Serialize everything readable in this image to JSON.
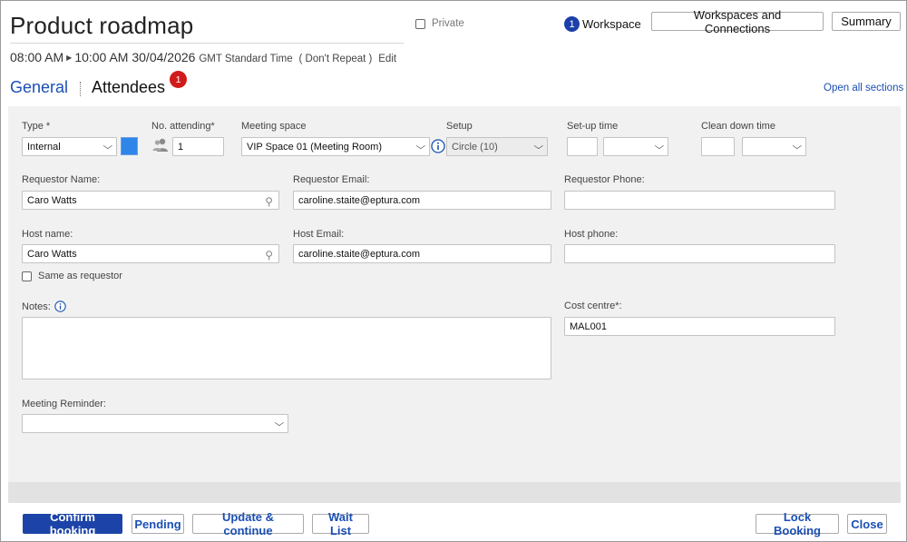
{
  "header": {
    "title": "Product roadmap",
    "start_time": "08:00 AM",
    "end_time": "10:00 AM 30/04/2026",
    "timezone": "GMT Standard Time",
    "repeat": "( Don't Repeat )",
    "edit_link": "Edit",
    "private_label": "Private",
    "workspace_count": "1",
    "workspace_label": "Workspace",
    "workspaces_connections_button": "Workspaces and Connections",
    "summary_button": "Summary"
  },
  "tabs": {
    "general": "General",
    "attendees": "Attendees",
    "attendees_badge": "1",
    "open_all_sections": "Open all sections"
  },
  "form": {
    "type": {
      "label": "Type *",
      "value": "Internal",
      "color": "#2f86e8"
    },
    "attending": {
      "label": "No. attending*",
      "value": "1"
    },
    "meeting_space": {
      "label": "Meeting space",
      "value": "VIP Space 01 (Meeting Room)"
    },
    "setup": {
      "label": "Setup",
      "value": "Circle (10)"
    },
    "setup_time": {
      "label": "Set-up time",
      "value": "",
      "unit": ""
    },
    "clean_time": {
      "label": "Clean down time",
      "value": "",
      "unit": ""
    },
    "requestor_name": {
      "label": "Requestor Name:",
      "value": "Caro Watts"
    },
    "requestor_email": {
      "label": "Requestor Email:",
      "value": "caroline.staite@eptura.com"
    },
    "requestor_phone": {
      "label": "Requestor Phone:",
      "value": ""
    },
    "host_name": {
      "label": "Host name:",
      "value": "Caro Watts"
    },
    "host_email": {
      "label": "Host Email:",
      "value": "caroline.staite@eptura.com"
    },
    "host_phone": {
      "label": "Host phone:",
      "value": ""
    },
    "same_as_requestor": "Same as requestor",
    "notes": {
      "label": "Notes:",
      "value": ""
    },
    "cost_centre": {
      "label": "Cost centre*:",
      "value": "MAL001"
    },
    "meeting_reminder": {
      "label": "Meeting Reminder:",
      "value": ""
    }
  },
  "footer": {
    "confirm": "Confirm booking",
    "pending": "Pending",
    "update": "Update & continue",
    "wait_list": "Wait List",
    "lock": "Lock Booking",
    "close": "Close"
  },
  "colors": {
    "accent": "#1c44a8",
    "link": "#1a4fb4",
    "badge": "#d11b1b"
  }
}
